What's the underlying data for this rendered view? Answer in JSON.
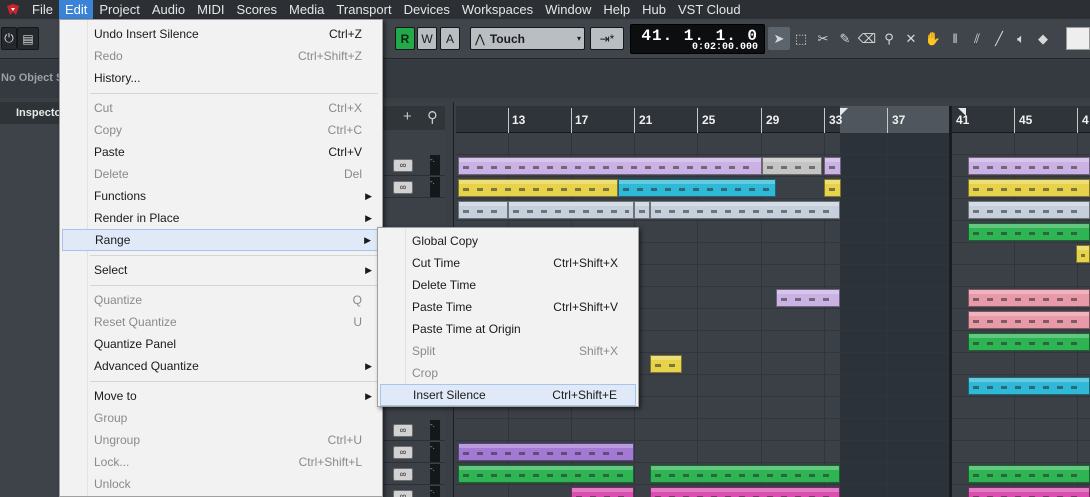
{
  "menubar": {
    "items": [
      "File",
      "Edit",
      "Project",
      "Audio",
      "MIDI",
      "Scores",
      "Media",
      "Transport",
      "Devices",
      "Workspaces",
      "Window",
      "Help",
      "Hub",
      "VST Cloud"
    ],
    "active": "Edit"
  },
  "toolbar": {
    "read_label": "R",
    "write_label": "W",
    "automation_a_label": "A",
    "automation_mode": "Touch",
    "position_bars": "41.  1.  1.   0",
    "position_time": "0:02:00.000",
    "accent_color": "#23a84a"
  },
  "info_line": {
    "no_object_text": "No Object S"
  },
  "inspector": {
    "tab_label": "Inspecto"
  },
  "track_list": {
    "add_label": "+",
    "button_glyph": "∞",
    "meter_glyph": "-."
  },
  "ruler": {
    "bars": [
      "13",
      "17",
      "21",
      "25",
      "29",
      "33",
      "37",
      "41",
      "45",
      "4"
    ]
  },
  "edit_menu": {
    "items": [
      {
        "label": "Undo Insert Silence",
        "shortcut": "Ctrl+Z",
        "disabled": false
      },
      {
        "label": "Redo",
        "shortcut": "Ctrl+Shift+Z",
        "disabled": true
      },
      {
        "label": "History...",
        "shortcut": "",
        "disabled": false
      },
      {
        "label": "Cut",
        "shortcut": "Ctrl+X",
        "disabled": true
      },
      {
        "label": "Copy",
        "shortcut": "Ctrl+C",
        "disabled": true
      },
      {
        "label": "Paste",
        "shortcut": "Ctrl+V",
        "disabled": false
      },
      {
        "label": "Delete",
        "shortcut": "Del",
        "disabled": true
      },
      {
        "label": "Functions",
        "shortcut": "",
        "disabled": false,
        "submenu": true
      },
      {
        "label": "Render in Place",
        "shortcut": "",
        "disabled": false,
        "submenu": true
      },
      {
        "label": "Range",
        "shortcut": "",
        "disabled": false,
        "submenu": true,
        "highlighted": true
      },
      {
        "label": "Select",
        "shortcut": "",
        "disabled": false,
        "submenu": true
      },
      {
        "label": "Quantize",
        "shortcut": "Q",
        "disabled": true
      },
      {
        "label": "Reset Quantize",
        "shortcut": "U",
        "disabled": true
      },
      {
        "label": "Quantize Panel",
        "shortcut": "",
        "disabled": false
      },
      {
        "label": "Advanced Quantize",
        "shortcut": "",
        "disabled": false,
        "submenu": true
      },
      {
        "label": "Move to",
        "shortcut": "",
        "disabled": false,
        "submenu": true
      },
      {
        "label": "Group",
        "shortcut": "",
        "disabled": true
      },
      {
        "label": "Ungroup",
        "shortcut": "Ctrl+U",
        "disabled": true
      },
      {
        "label": "Lock...",
        "shortcut": "Ctrl+Shift+L",
        "disabled": true
      },
      {
        "label": "Unlock",
        "shortcut": "",
        "disabled": true
      }
    ]
  },
  "range_menu": {
    "items": [
      {
        "label": "Global Copy",
        "shortcut": "",
        "disabled": false
      },
      {
        "label": "Cut Time",
        "shortcut": "Ctrl+Shift+X",
        "disabled": false
      },
      {
        "label": "Delete Time",
        "shortcut": "",
        "disabled": false
      },
      {
        "label": "Paste Time",
        "shortcut": "Ctrl+Shift+V",
        "disabled": false
      },
      {
        "label": "Paste Time at Origin",
        "shortcut": "",
        "disabled": false
      },
      {
        "label": "Split",
        "shortcut": "Shift+X",
        "disabled": true
      },
      {
        "label": "Crop",
        "shortcut": "",
        "disabled": true
      },
      {
        "label": "Insert Silence",
        "shortcut": "Ctrl+Shift+E",
        "disabled": false,
        "highlighted": true
      }
    ]
  }
}
